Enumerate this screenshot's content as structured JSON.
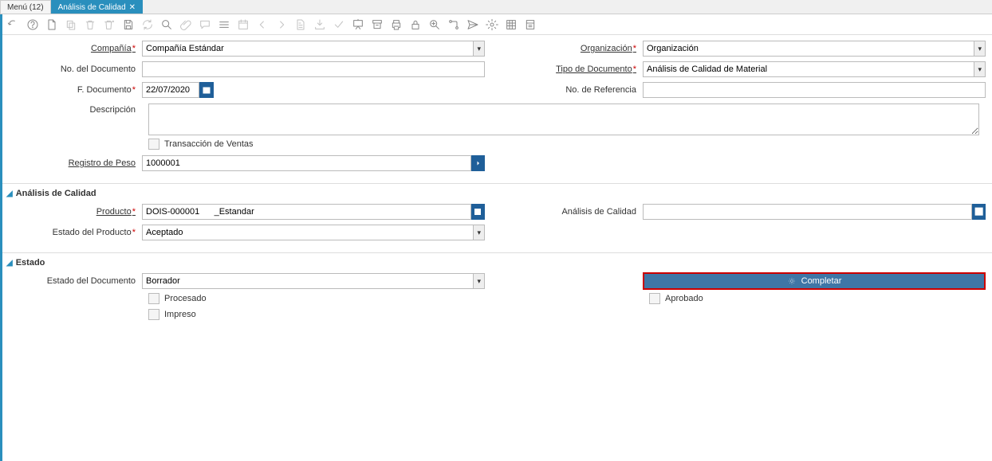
{
  "tabs": {
    "menu_label": "Menú (12)",
    "active_label": "Análisis de Calidad"
  },
  "header": {
    "company_label": "Compañía",
    "company_value": "Compañía Estándar",
    "org_label": "Organización",
    "org_value": "Organización",
    "docno_label": "No. del Documento",
    "docno_value": "",
    "doctype_label": "Tipo de Documento",
    "doctype_value": "Análisis de Calidad de Material",
    "docdate_label": "F. Documento",
    "docdate_value": "22/07/2020",
    "refno_label": "No. de Referencia",
    "refno_value": "",
    "desc_label": "Descripción",
    "desc_value": "",
    "salestrx_label": "Transacción de Ventas",
    "weightrec_label": "Registro de Peso",
    "weightrec_value": "1000001"
  },
  "qa": {
    "section_title": "Análisis de Calidad",
    "product_label": "Producto",
    "product_value": "DOIS-000001      _Estandar",
    "qa_label": "Análisis de Calidad",
    "qa_value": "",
    "prodstatus_label": "Estado del Producto",
    "prodstatus_value": "Aceptado"
  },
  "status": {
    "section_title": "Estado",
    "docstatus_label": "Estado del Documento",
    "docstatus_value": "Borrador",
    "complete_label": "Completar",
    "processed_label": "Procesado",
    "approved_label": "Aprobado",
    "printed_label": "Impreso"
  }
}
